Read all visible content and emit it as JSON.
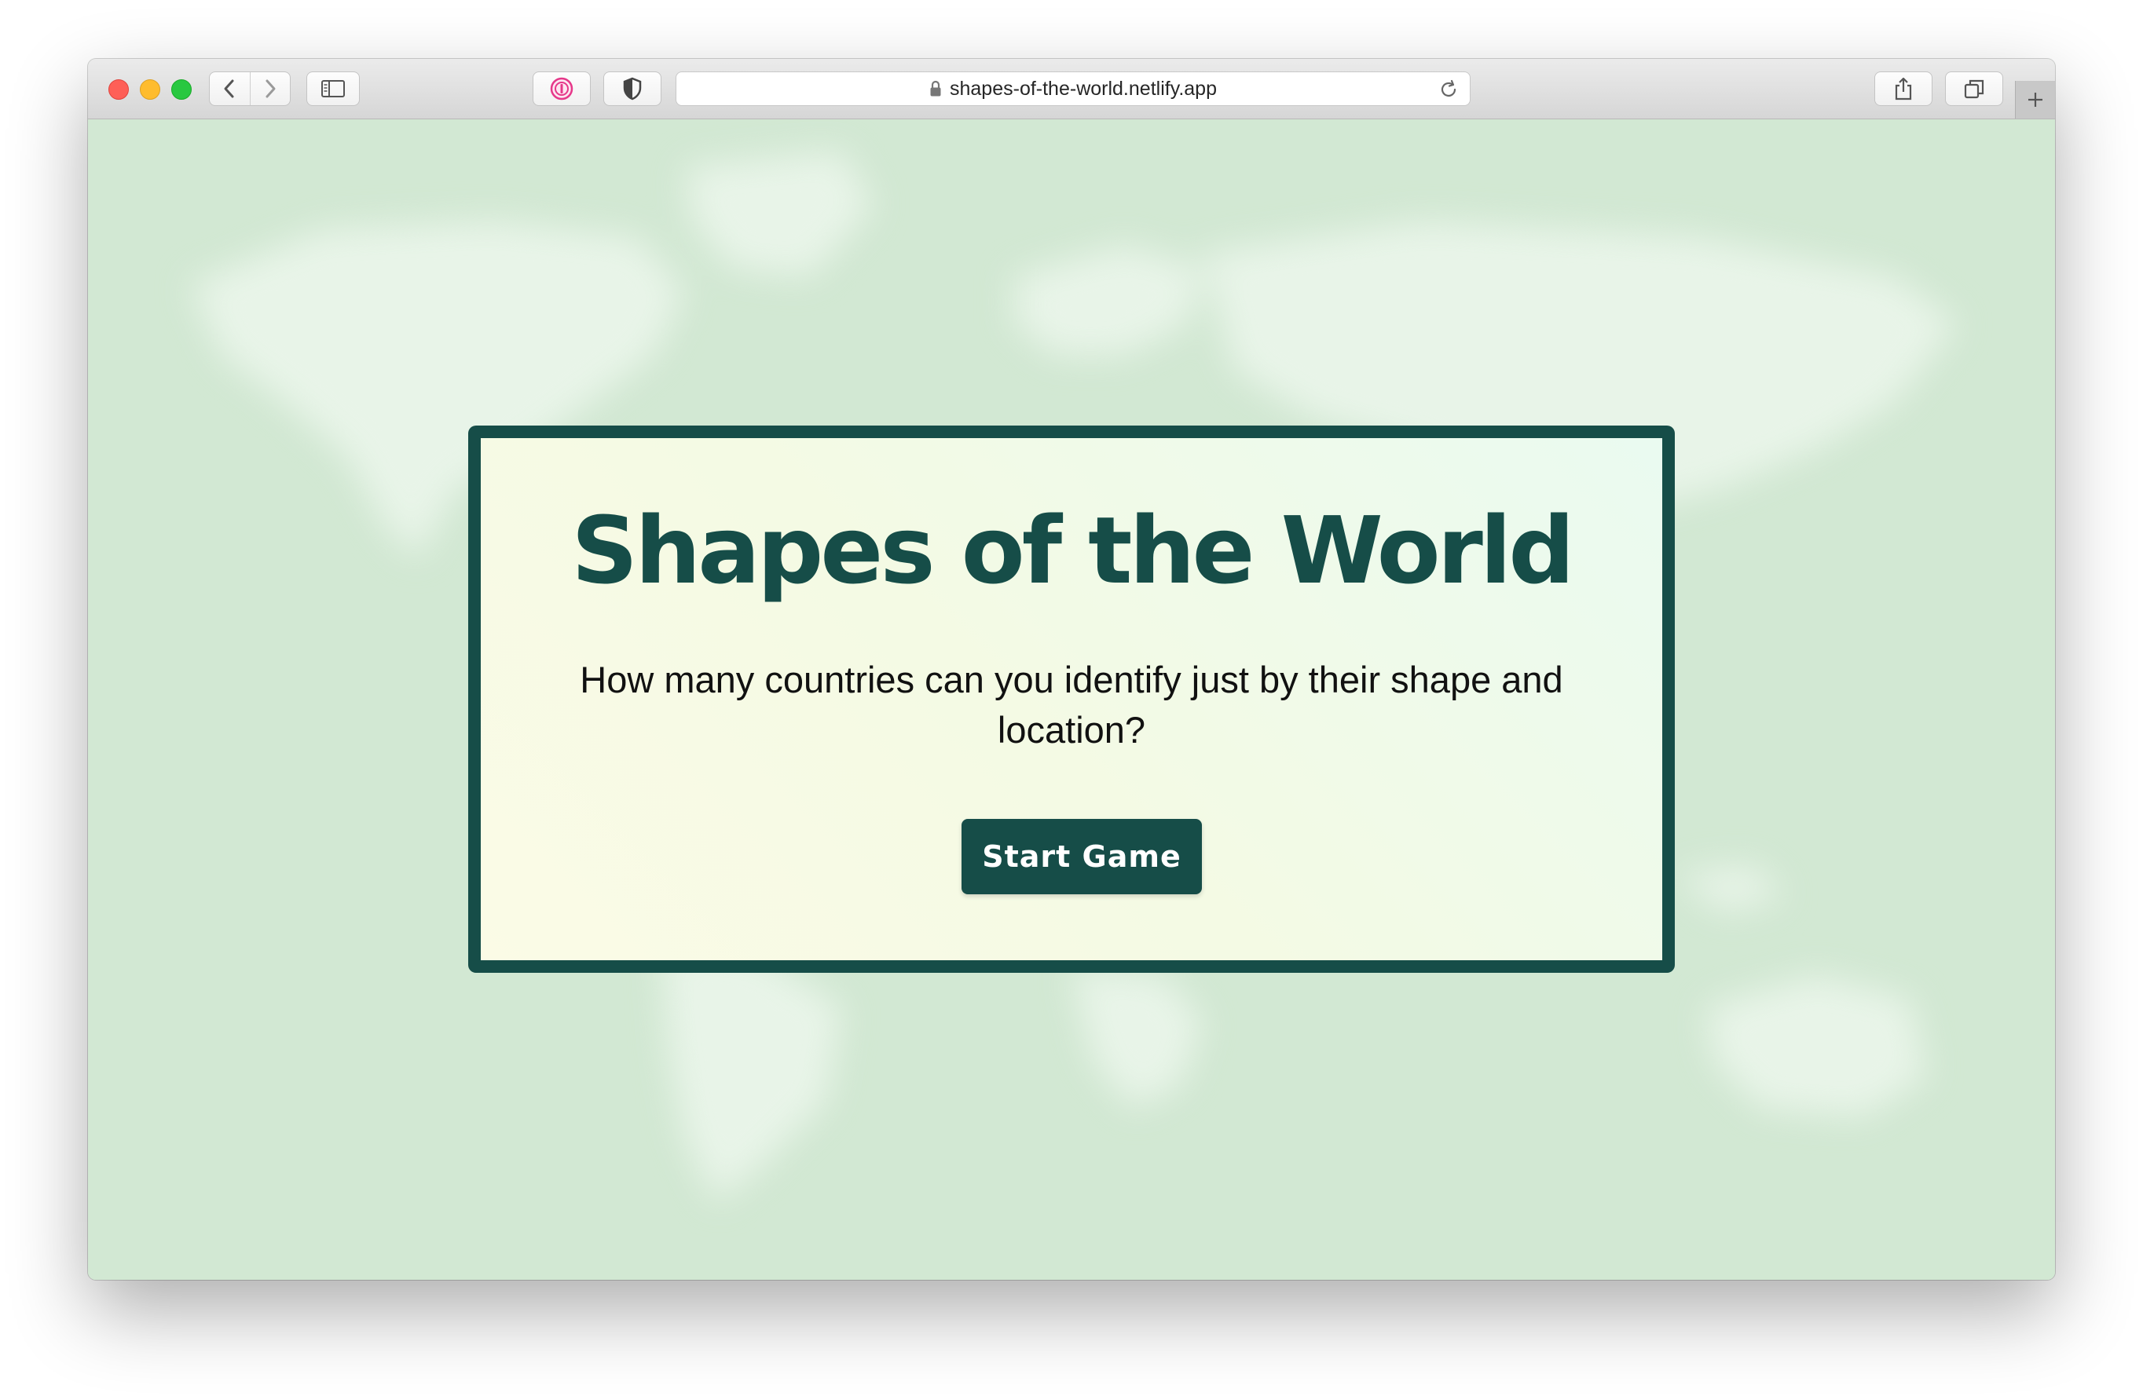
{
  "browser": {
    "url": "shapes-of-the-world.netlify.app",
    "icons": {
      "back": "chevron-left-icon",
      "forward": "chevron-right-icon",
      "sidebar": "sidebar-icon",
      "password_manager": "1password-icon",
      "privacy": "shield-icon",
      "lock": "lock-icon",
      "reload": "reload-icon",
      "share": "share-icon",
      "tabs": "tabs-overview-icon",
      "new_tab": "plus-icon"
    }
  },
  "page": {
    "title": "Shapes of the World",
    "description": "How many countries can you identify just by their shape and location?",
    "start_button": "Start Game"
  },
  "colors": {
    "brand": "#164d48",
    "background": "#d2e8d3",
    "card": "#f6fbe6"
  }
}
